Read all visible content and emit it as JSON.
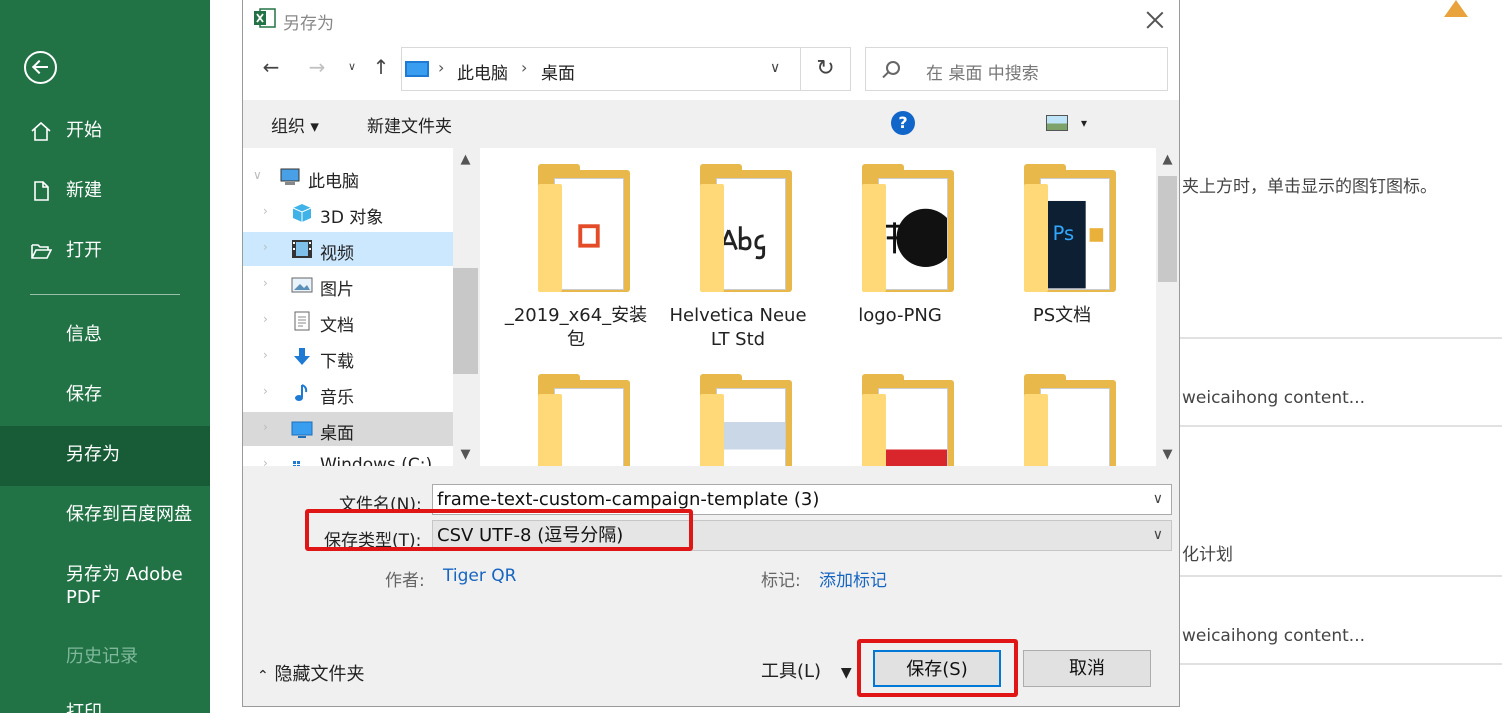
{
  "sidebar": {
    "items": [
      {
        "label": "开始"
      },
      {
        "label": "新建"
      },
      {
        "label": "打开"
      },
      {
        "label": "信息"
      },
      {
        "label": "保存"
      },
      {
        "label": "另存为"
      },
      {
        "label": "保存到百度网盘"
      },
      {
        "label": "另存为 Adobe PDF"
      },
      {
        "label": "历史记录"
      },
      {
        "label": "打印"
      }
    ]
  },
  "background": {
    "pin_tip": "夹上方时，单击显示的图钉图标。",
    "row1": "weicaihong content...",
    "row2": "化计划",
    "row3": "weicaihong content..."
  },
  "dialog": {
    "title": "另存为",
    "breadcrumb": [
      "此电脑",
      "桌面"
    ],
    "search_placeholder": "在 桌面 中搜索",
    "toolbar": {
      "organize": "组织",
      "new_folder": "新建文件夹",
      "help": "?"
    },
    "tree": [
      {
        "label": "此电脑",
        "icon": "computer-icon"
      },
      {
        "label": "3D 对象",
        "icon": "3d-objects-icon"
      },
      {
        "label": "视频",
        "icon": "video-icon"
      },
      {
        "label": "图片",
        "icon": "pictures-icon"
      },
      {
        "label": "文档",
        "icon": "documents-icon"
      },
      {
        "label": "下载",
        "icon": "download-icon"
      },
      {
        "label": "音乐",
        "icon": "music-icon"
      },
      {
        "label": "桌面",
        "icon": "desktop-icon"
      },
      {
        "label": "Windows (C:)",
        "icon": "drive-icon"
      }
    ],
    "files": [
      {
        "name": "_2019_x64_安装包",
        "preview": "office-icon"
      },
      {
        "name": "Helvetica Neue LT Std",
        "preview": "font-preview-icon"
      },
      {
        "name": "logo-PNG",
        "preview": "logo-preview-icon"
      },
      {
        "name": "PS文档",
        "preview": "photoshop-icon"
      },
      {
        "name": "",
        "preview": "folder-icon"
      },
      {
        "name": "",
        "preview": "folder-icon"
      },
      {
        "name": "",
        "preview": "folder-icon"
      },
      {
        "name": "",
        "preview": "folder-icon"
      }
    ],
    "filename_label": "文件名(N):",
    "filename_value": "frame-text-custom-campaign-template (3)",
    "filetype_label": "保存类型(T):",
    "filetype_value": "CSV UTF-8 (逗号分隔)",
    "author_label": "作者:",
    "author_value": "Tiger QR",
    "tags_label": "标记:",
    "tags_value": "添加标记",
    "hide_folders": "隐藏文件夹",
    "tools": "工具(L)",
    "save": "保存(S)",
    "cancel": "取消"
  },
  "colors": {
    "excel_green": "#217346",
    "excel_green_active": "#185c37",
    "highlight_red": "#e01616",
    "link_blue": "#1665c0"
  }
}
